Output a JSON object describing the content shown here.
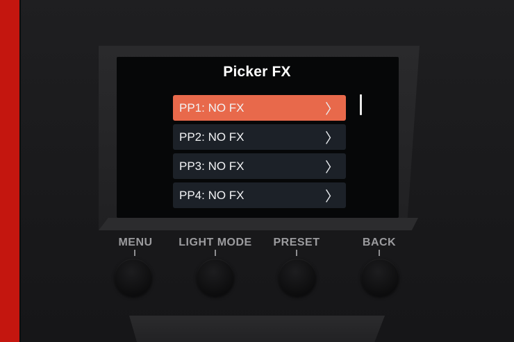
{
  "screen": {
    "title": "Picker FX",
    "items": [
      {
        "label": "PP1: NO FX",
        "selected": true
      },
      {
        "label": "PP2: NO FX",
        "selected": false
      },
      {
        "label": "PP3: NO FX",
        "selected": false
      },
      {
        "label": "PP4: NO FX",
        "selected": false
      }
    ],
    "chevron": "〉"
  },
  "buttons": [
    {
      "label": "MENU"
    },
    {
      "label": "LIGHT MODE"
    },
    {
      "label": "PRESET"
    },
    {
      "label": "BACK"
    }
  ],
  "colors": {
    "selected_row": "#e8694b",
    "row": "#1c2128",
    "device_body": "#1c1c1e",
    "background": "#c4160f"
  }
}
